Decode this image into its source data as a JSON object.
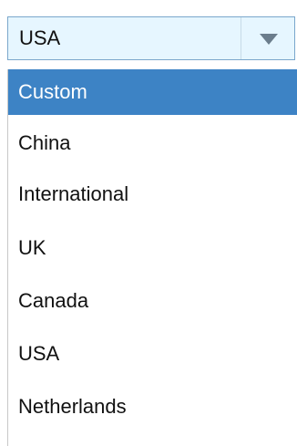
{
  "select": {
    "value": "USA",
    "arrow_icon": "chevron-down-icon"
  },
  "dropdown": {
    "highlighted_index": 0,
    "options": [
      "Custom",
      "China",
      "International",
      "UK",
      "Canada",
      "USA",
      "Netherlands"
    ]
  },
  "colors": {
    "select_bg": "#e6f6ff",
    "highlight_bg": "#3d83c5"
  }
}
